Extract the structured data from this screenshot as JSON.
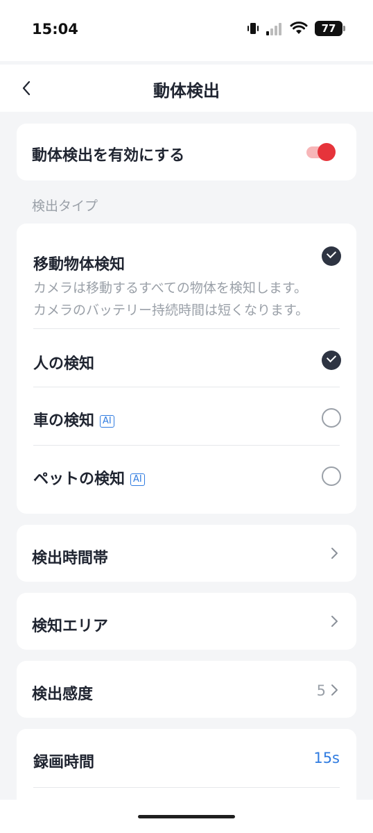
{
  "status_bar": {
    "time": "15:04",
    "battery": "77"
  },
  "header": {
    "title": "動体検出"
  },
  "enable_card": {
    "label": "動体検出を有効にする",
    "enabled": true,
    "accent_color": "#e6343b"
  },
  "detection_type": {
    "section_label": "検出タイプ",
    "items": [
      {
        "label": "移動物体検知",
        "checked": true,
        "description_line1": "カメラは移動するすべての物体を検知します。",
        "description_line2": "カメラのバッテリー持続時間は短くなります。"
      },
      {
        "label": "人の検知",
        "checked": true
      },
      {
        "label": "車の検知",
        "checked": false,
        "badge": "AI"
      },
      {
        "label": "ペットの検知",
        "checked": false,
        "badge": "AI"
      }
    ]
  },
  "settings": [
    {
      "label": "検出時間帯"
    },
    {
      "label": "検知エリア"
    },
    {
      "label": "検出感度",
      "value": "5"
    }
  ],
  "recording": {
    "label": "録画時間",
    "value": "15s",
    "value_color": "#2f7be0"
  }
}
